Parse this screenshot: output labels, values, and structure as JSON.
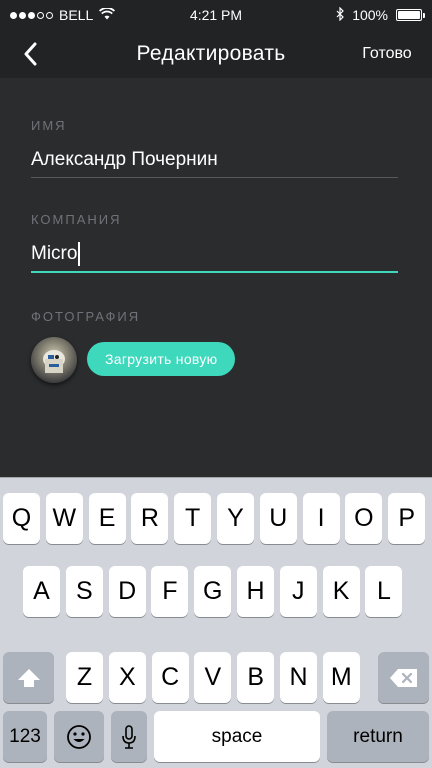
{
  "status_bar": {
    "carrier": "BELL",
    "time": "4:21 PM",
    "battery": "100%",
    "battery_level": 1.0,
    "signal_bars_filled": 3,
    "signal_bars_total": 5
  },
  "nav": {
    "title": "Редактировать",
    "done_label": "Готово",
    "back_icon": "chevron-left-icon"
  },
  "form": {
    "name_label": "ИМЯ",
    "name_value": "Александр Почернин",
    "company_label": "КОМПАНИЯ",
    "company_value": "Micro",
    "photo_label": "ФОТОГРАФИЯ",
    "upload_label": "Загрузить новую"
  },
  "colors": {
    "background": "#2b2c2e",
    "header": "#222325",
    "accent": "#3ed8bd",
    "label": "#6f7278"
  },
  "keyboard": {
    "row1": [
      "Q",
      "W",
      "E",
      "R",
      "T",
      "Y",
      "U",
      "I",
      "O",
      "P"
    ],
    "row2": [
      "A",
      "S",
      "D",
      "F",
      "G",
      "H",
      "J",
      "K",
      "L"
    ],
    "row3": [
      "Z",
      "X",
      "C",
      "V",
      "B",
      "N",
      "M"
    ],
    "numbers_label": "123",
    "space_label": "space",
    "return_label": "return"
  }
}
